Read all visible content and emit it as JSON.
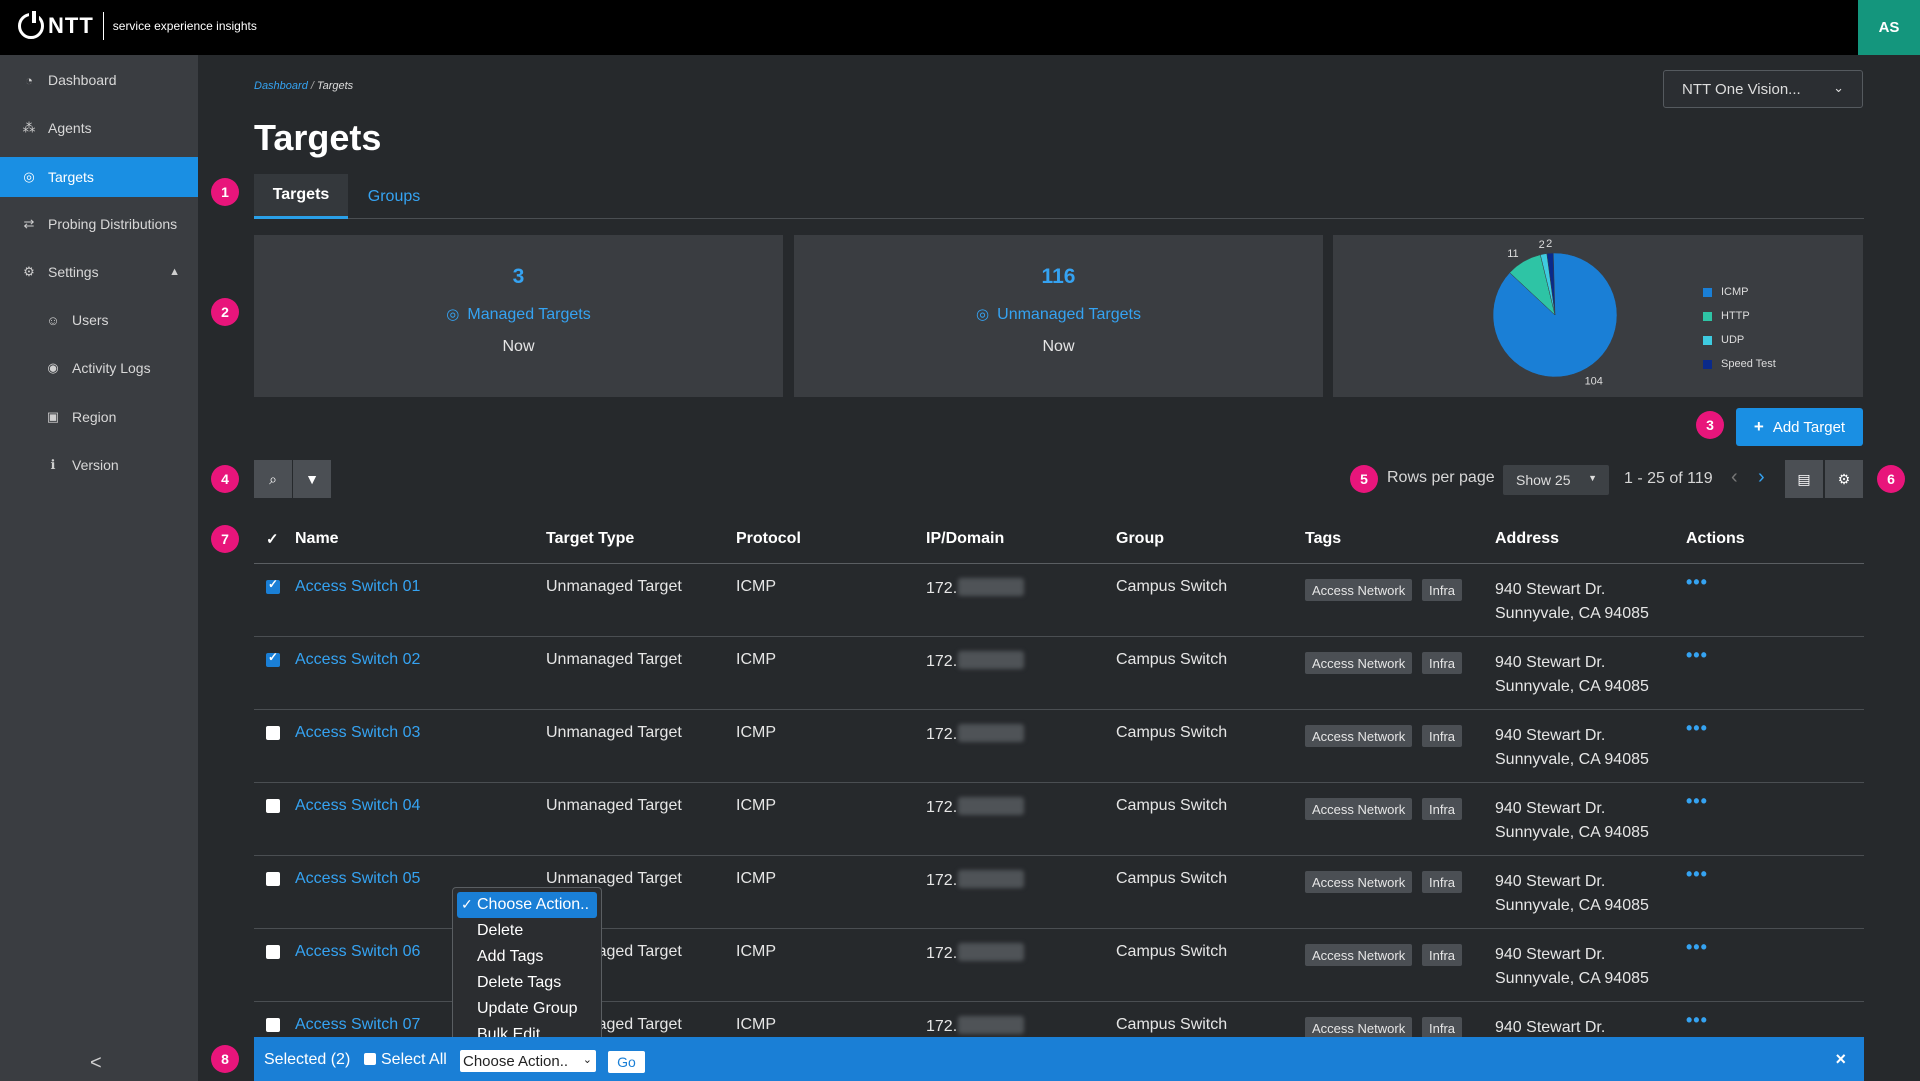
{
  "header": {
    "brand": "NTT",
    "tagline": "service experience insights",
    "avatar": "AS"
  },
  "sidebar": {
    "items": [
      {
        "label": "Dashboard",
        "icon": "dashboard-icon"
      },
      {
        "label": "Agents",
        "icon": "agents-icon"
      },
      {
        "label": "Targets",
        "icon": "target-icon",
        "active": true
      },
      {
        "label": "Probing Distributions",
        "icon": "exchange-icon"
      },
      {
        "label": "Settings",
        "icon": "gear-icon"
      },
      {
        "label": "Users",
        "icon": "users-icon"
      },
      {
        "label": "Activity Logs",
        "icon": "eye-icon"
      },
      {
        "label": "Region",
        "icon": "id-card-icon"
      },
      {
        "label": "Version",
        "icon": "info-icon"
      }
    ],
    "collapse": "<"
  },
  "breadcrumb": {
    "home": "Dashboard",
    "separator": "/",
    "current": "Targets"
  },
  "page_title": "Targets",
  "org_select": "NTT One Vision...",
  "tabs": [
    "Targets",
    "Groups"
  ],
  "cards": {
    "managed": {
      "count": "3",
      "label": "Managed Targets",
      "time": "Now"
    },
    "unmanaged": {
      "count": "116",
      "label": "Unmanaged Targets",
      "time": "Now"
    }
  },
  "chart_data": {
    "type": "pie",
    "categories": [
      "ICMP",
      "HTTP",
      "UDP",
      "Speed Test"
    ],
    "values": [
      104,
      11,
      2,
      2
    ],
    "data_labels": [
      "104",
      "11",
      "2",
      "2"
    ],
    "colors": [
      "#1a7fd6",
      "#2ec4a5",
      "#3ecbe0",
      "#0a2a8a"
    ],
    "legend_position": "right"
  },
  "badges": [
    "1",
    "2",
    "3",
    "4",
    "5",
    "6",
    "7",
    "8"
  ],
  "add_target": "Add Target",
  "pagination": {
    "rows_per_page_label": "Rows per page",
    "rows_per_page": "Show 25",
    "range": "1 - 25 of 119"
  },
  "table": {
    "columns": [
      "Name",
      "Target Type",
      "Protocol",
      "IP/Domain",
      "Group",
      "Tags",
      "Address",
      "Actions"
    ],
    "rows": [
      {
        "name": "Access Switch 01",
        "type": "Unmanaged Target",
        "protocol": "ICMP",
        "ip": "172.",
        "group": "Campus Switch",
        "tags": [
          "Access Network",
          "Infra"
        ],
        "addr1": "940 Stewart Dr.",
        "addr2": "Sunnyvale, CA 94085",
        "checked": true
      },
      {
        "name": "Access Switch 02",
        "type": "Unmanaged Target",
        "protocol": "ICMP",
        "ip": "172.",
        "group": "Campus Switch",
        "tags": [
          "Access Network",
          "Infra"
        ],
        "addr1": "940 Stewart Dr.",
        "addr2": "Sunnyvale, CA 94085",
        "checked": true
      },
      {
        "name": "Access Switch 03",
        "type": "Unmanaged Target",
        "protocol": "ICMP",
        "ip": "172.",
        "group": "Campus Switch",
        "tags": [
          "Access Network",
          "Infra"
        ],
        "addr1": "940 Stewart Dr.",
        "addr2": "Sunnyvale, CA 94085",
        "checked": false
      },
      {
        "name": "Access Switch 04",
        "type": "Unmanaged Target",
        "protocol": "ICMP",
        "ip": "172.",
        "group": "Campus Switch",
        "tags": [
          "Access Network",
          "Infra"
        ],
        "addr1": "940 Stewart Dr.",
        "addr2": "Sunnyvale, CA 94085",
        "checked": false
      },
      {
        "name": "Access Switch 05",
        "type": "Unmanaged Target",
        "protocol": "ICMP",
        "ip": "172.",
        "group": "Campus Switch",
        "tags": [
          "Access Network",
          "Infra"
        ],
        "addr1": "940 Stewart Dr.",
        "addr2": "Sunnyvale, CA 94085",
        "checked": false
      },
      {
        "name": "Access Switch 06",
        "type": "Unmanaged Target",
        "protocol": "ICMP",
        "ip": "172.",
        "group": "Campus Switch",
        "tags": [
          "Access Network",
          "Infra"
        ],
        "addr1": "940 Stewart Dr.",
        "addr2": "Sunnyvale, CA 94085",
        "checked": false
      },
      {
        "name": "Access Switch 07",
        "type": "Unmanaged Target",
        "protocol": "ICMP",
        "ip": "172.",
        "group": "Campus Switch",
        "tags": [
          "Access Network",
          "Infra"
        ],
        "addr1": "940 Stewart Dr.",
        "addr2": "",
        "checked": false
      }
    ]
  },
  "action_bar": {
    "selected": "Selected (2)",
    "select_all": "Select All",
    "choose": "Choose Action..",
    "go": "Go",
    "close": "×"
  },
  "dropdown": {
    "options": [
      "Choose Action..",
      "Delete",
      "Add Tags",
      "Delete Tags",
      "Update Group",
      "Bulk Edit"
    ],
    "selected_mark": "✓"
  }
}
